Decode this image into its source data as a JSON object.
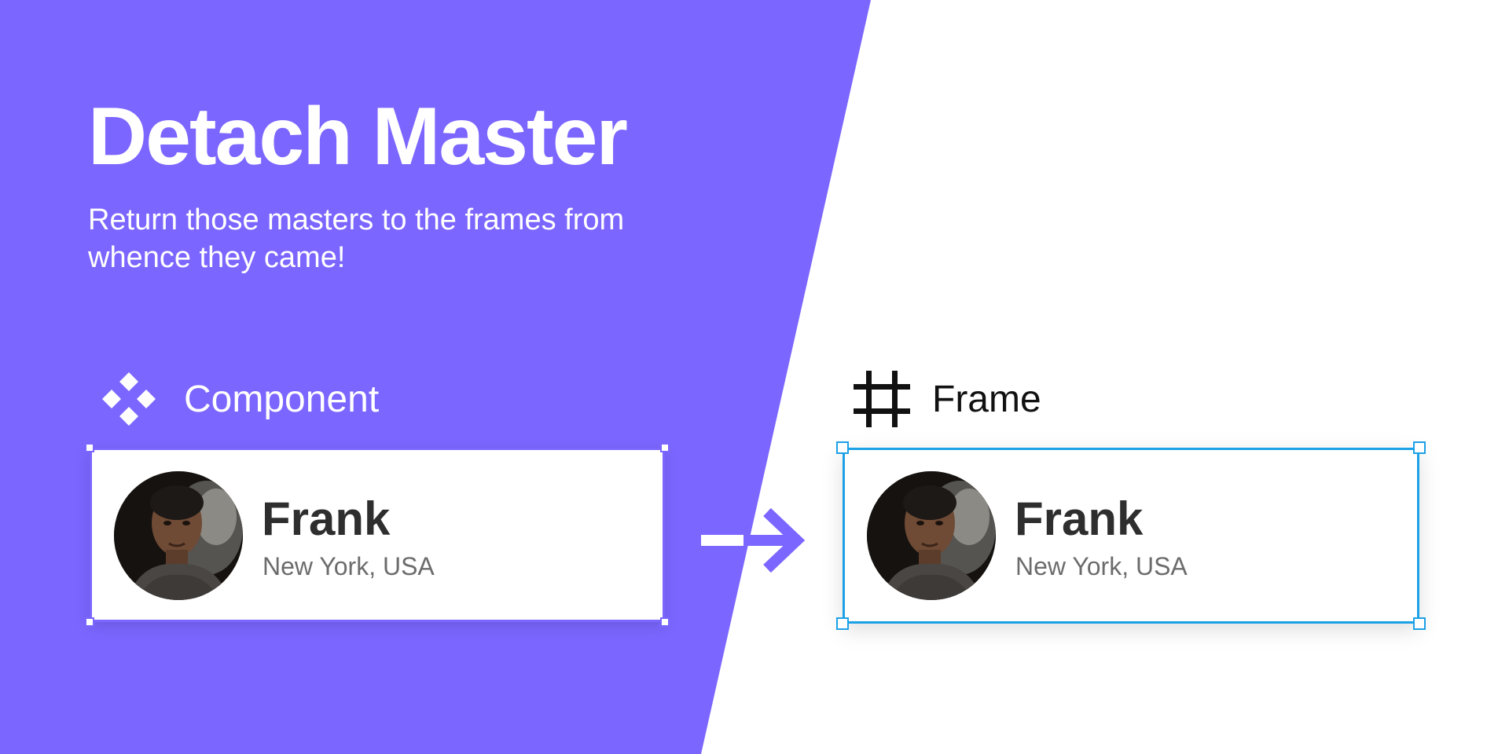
{
  "header": {
    "title": "Detach Master",
    "subtitle": "Return those masters to the frames from whence they came!"
  },
  "left_panel": {
    "section_label": "Component",
    "icon": "component-icon",
    "card": {
      "name": "Frank",
      "location": "New York, USA"
    }
  },
  "right_panel": {
    "section_label": "Frame",
    "icon": "frame-icon",
    "card": {
      "name": "Frank",
      "location": "New York, USA"
    }
  },
  "transition_icon": "arrow-right-icon",
  "colors": {
    "accent_purple": "#7b66ff",
    "frame_selection_blue": "#1da1e6",
    "background_white": "#ffffff",
    "name_text": "#2e2e2e",
    "location_text": "#6c6c6c"
  }
}
